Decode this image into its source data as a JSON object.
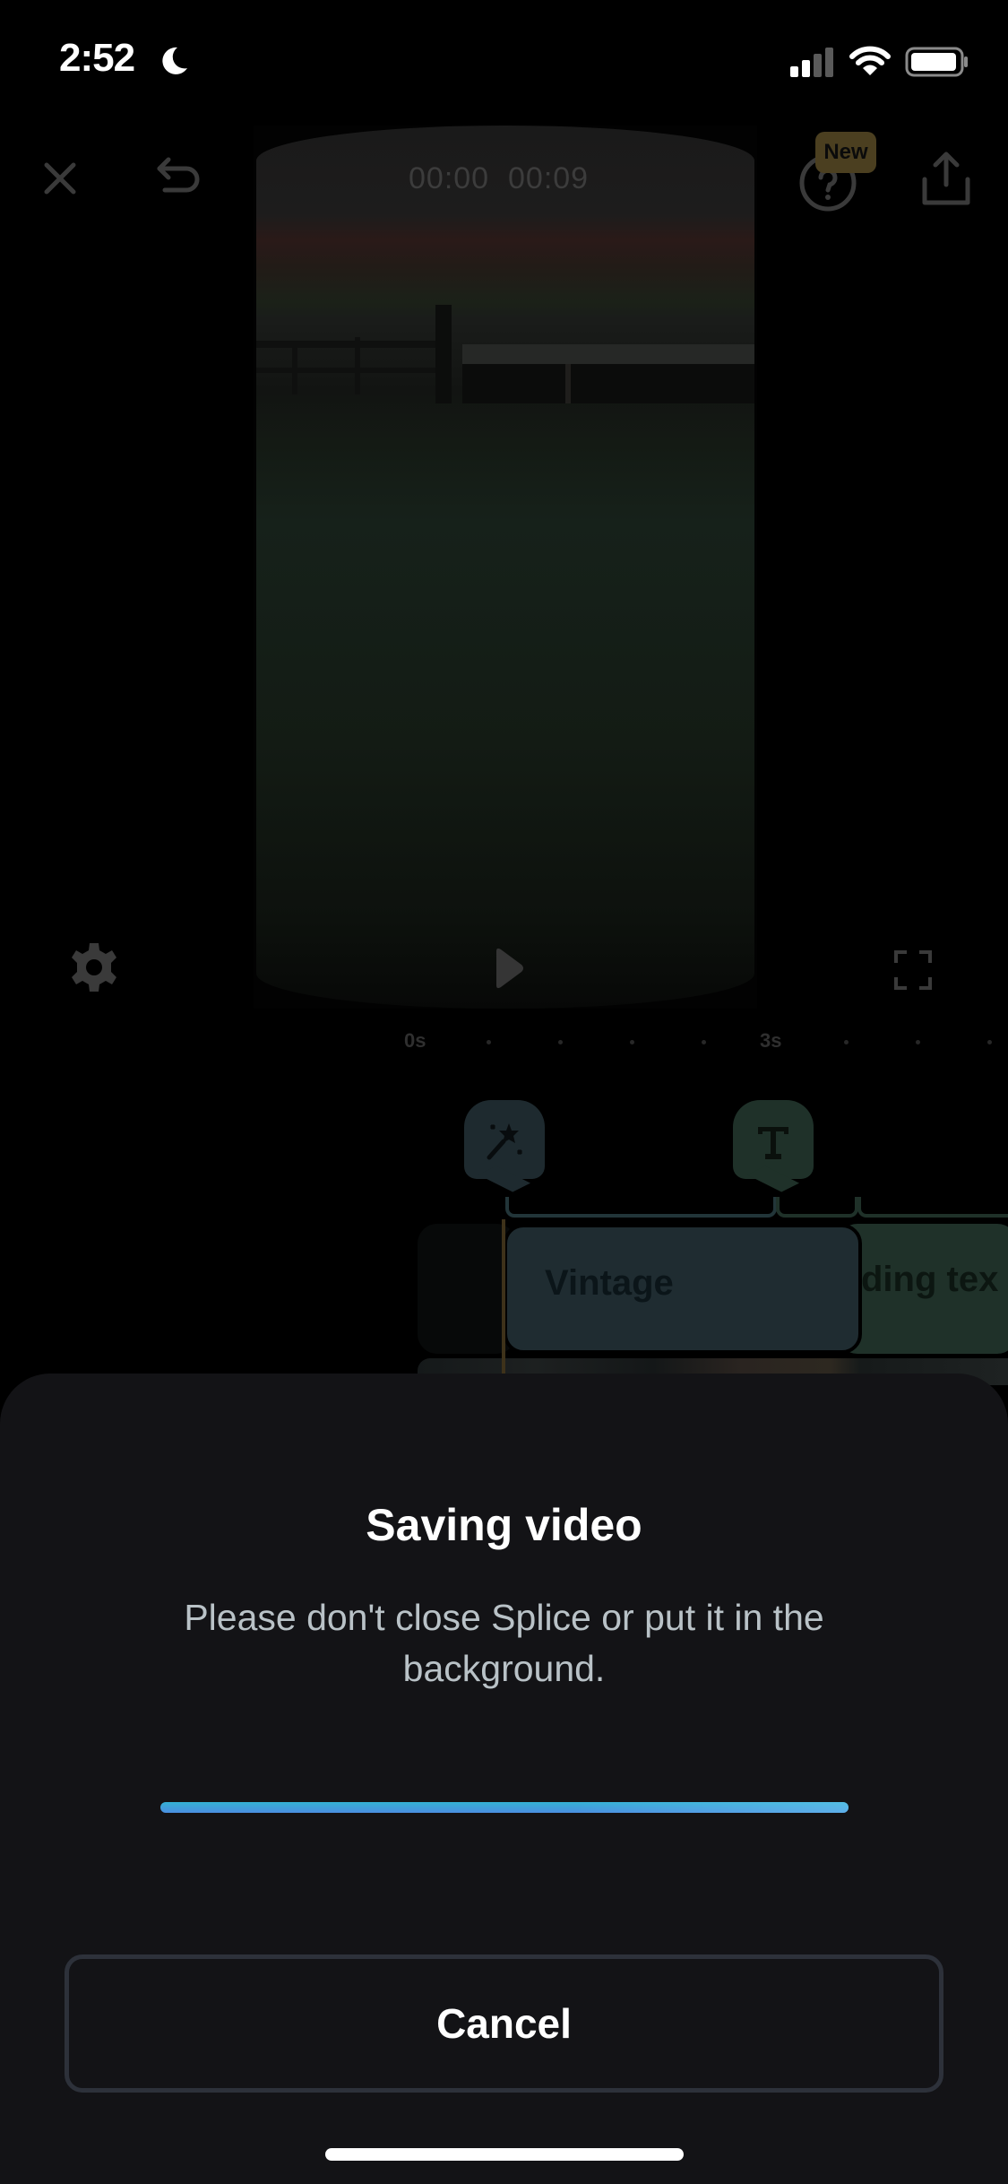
{
  "status_bar": {
    "time": "2:52",
    "focus_icon": "moon-icon",
    "signal_bars_active": 2,
    "signal_bars_total": 4,
    "wifi_icon": "wifi-icon",
    "battery_level": 0.85
  },
  "editor": {
    "close_icon": "close-icon",
    "undo_icon": "undo-icon",
    "help_icon": "help-circle-icon",
    "help_badge": "New",
    "share_icon": "share-icon",
    "timecode_current": "00:00",
    "timecode_total": "00:09",
    "settings_icon": "gear-icon",
    "play_icon": "play-icon",
    "fullscreen_icon": "fullscreen-icon",
    "ruler": {
      "labels": [
        "0s",
        "3s"
      ]
    },
    "markers": [
      {
        "type": "effect",
        "icon": "magic-wand-icon",
        "color": "#1e2a2f"
      },
      {
        "type": "text",
        "icon": "text-icon",
        "color": "#1f3129"
      }
    ],
    "clips": [
      {
        "label": "Vintage",
        "color": "#1f2c31"
      },
      {
        "label": "Heading text",
        "visible_label": "ding tex",
        "color": "#1f3129"
      }
    ],
    "playhead_color": "#3e321a"
  },
  "saving_sheet": {
    "title": "Saving video",
    "message": "Please don't close Splice or put it in the background.",
    "progress": 1.0,
    "progress_colors": [
      "#34b1d4",
      "#4b8ee0",
      "#65c6ee"
    ],
    "cancel_label": "Cancel"
  }
}
